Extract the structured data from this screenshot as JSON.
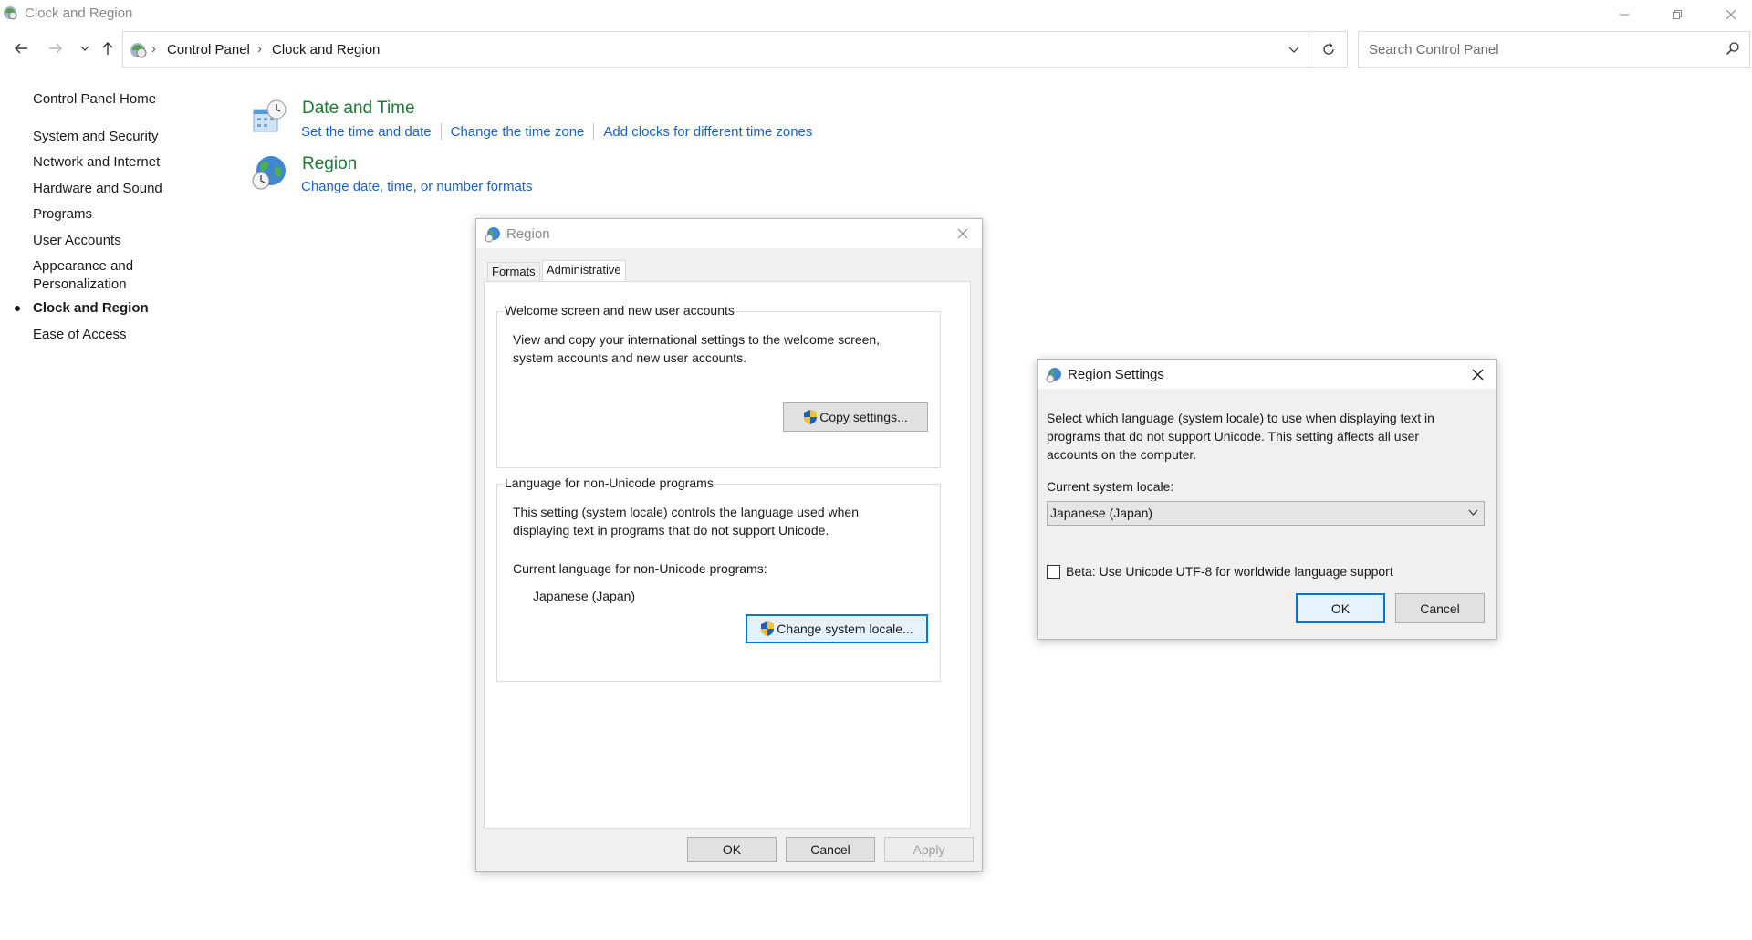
{
  "window": {
    "title": "Clock and Region"
  },
  "address_bar": {
    "breadcrumbs": [
      "Control Panel",
      "Clock and Region"
    ]
  },
  "search": {
    "placeholder": "Search Control Panel"
  },
  "sidebar": {
    "items": [
      {
        "label": "Control Panel Home",
        "active": false
      },
      {
        "label": "System and Security",
        "active": false
      },
      {
        "label": "Network and Internet",
        "active": false
      },
      {
        "label": "Hardware and Sound",
        "active": false
      },
      {
        "label": "Programs",
        "active": false
      },
      {
        "label": "User Accounts",
        "active": false
      },
      {
        "label": "Appearance and",
        "active": false
      },
      {
        "label": "Personalization",
        "active": false
      },
      {
        "label": "Clock and Region",
        "active": true
      },
      {
        "label": "Ease of Access",
        "active": false
      }
    ]
  },
  "categories": [
    {
      "title": "Date and Time",
      "icon": "clock-calendar-icon",
      "links": [
        "Set the time and date",
        "Change the time zone",
        "Add clocks for different time zones"
      ]
    },
    {
      "title": "Region",
      "icon": "globe-clock-icon",
      "links": [
        "Change date, time, or number formats"
      ]
    }
  ],
  "region_dialog": {
    "title": "Region",
    "tabs": [
      "Formats",
      "Administrative"
    ],
    "active_tab": "Administrative",
    "welcome_group": {
      "legend": "Welcome screen and new user accounts",
      "text_line1": "View and copy your international settings to the welcome screen,",
      "text_line2": "system accounts and new user accounts.",
      "button": "Copy settings..."
    },
    "unicode_group": {
      "legend": "Language for non-Unicode programs",
      "text_line1": "This setting (system locale) controls the language used when",
      "text_line2": "displaying text in programs that do not support Unicode.",
      "current_label": "Current language for non-Unicode programs:",
      "current_value": "Japanese (Japan)",
      "button": "Change system locale..."
    },
    "buttons": {
      "ok": "OK",
      "cancel": "Cancel",
      "apply": "Apply"
    }
  },
  "region_settings_dialog": {
    "title": "Region Settings",
    "description_line1": "Select which language (system locale) to use when displaying text in",
    "description_line2": "programs that do not support Unicode. This setting affects all user",
    "description_line3": "accounts on the computer.",
    "locale_label": "Current system locale:",
    "locale_value": "Japanese (Japan)",
    "beta_checkbox_label": "Beta: Use Unicode UTF-8 for worldwide language support",
    "beta_checked": false,
    "buttons": {
      "ok": "OK",
      "cancel": "Cancel"
    }
  },
  "colors": {
    "category_title": "#1e7a35",
    "link": "#1a62c5",
    "accent": "#0078d7"
  }
}
